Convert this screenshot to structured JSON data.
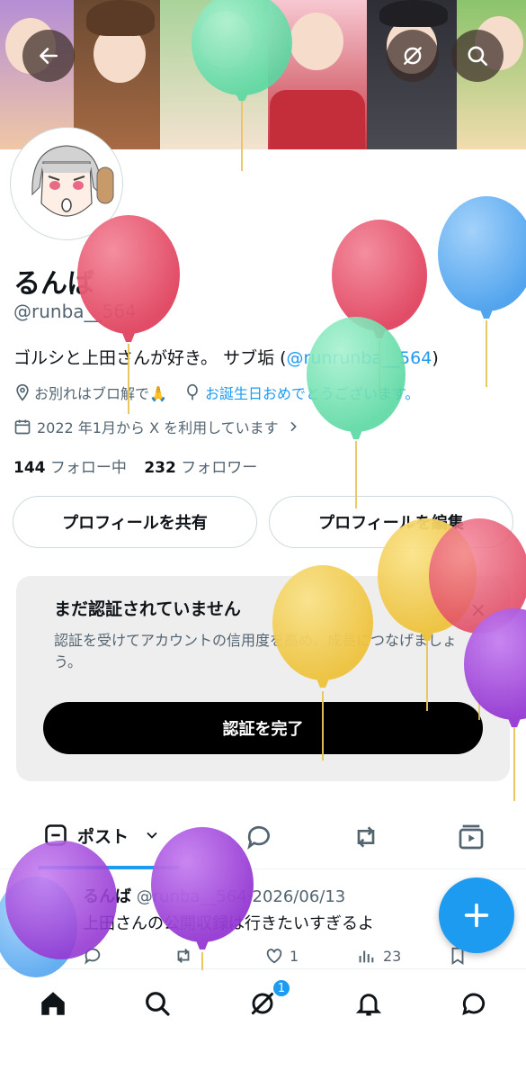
{
  "header": {
    "back_icon": "arrow-left-icon",
    "grok_icon": "grok-icon",
    "search_icon": "search-icon"
  },
  "profile": {
    "display_name": "るんば",
    "handle": "@runba__564",
    "bio_text": "ゴルシと上田さんが好き。 サブ垢 (",
    "bio_link": "@runrunba__564",
    "bio_end": ")",
    "location": "お別れはブロ解で🙏",
    "birthday": "お誕生日おめでとうございます。",
    "joined": "2022 年1月から X を利用しています",
    "following_count": "144",
    "following_label": "フォロー中",
    "followers_count": "232",
    "followers_label": "フォロワー"
  },
  "buttons": {
    "share_profile": "プロフィールを共有",
    "edit_profile": "プロフィールを編集"
  },
  "verify": {
    "title": "まだ認証されていません",
    "description": "認証を受けてアカウントの信用度を高め、成長につなげましょう。",
    "button": "認証を完了",
    "close": "×"
  },
  "tabs": {
    "posts_label": "ポスト"
  },
  "post": {
    "name": "るんば",
    "handle": "@runba__564",
    "date": "·2026/06/13",
    "text": "上田さんの公開収録は行きたいすぎるよ",
    "likes": "1",
    "views": "23"
  },
  "nav": {
    "notification_badge": "1"
  },
  "colors": {
    "accent": "#1d9bf0",
    "text": "#0f1419",
    "muted": "#536471",
    "balloon_red": "#e5536b",
    "balloon_blue": "#5aaef0",
    "balloon_green": "#6ee0b0",
    "balloon_yellow": "#f2cb4e",
    "balloon_purple": "#a44ad8"
  }
}
